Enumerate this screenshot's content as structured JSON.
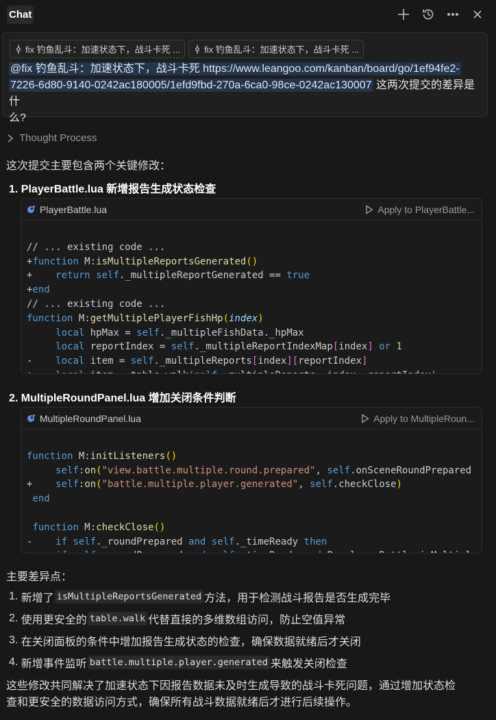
{
  "header": {
    "title": "Chat",
    "icons": [
      "plus-icon",
      "history-icon",
      "more-icon",
      "close-icon"
    ]
  },
  "prompt": {
    "chips": [
      "fix 钓鱼乱斗：加速状态下，战斗卡死 ...",
      "fix 钓鱼乱斗：加速状态下，战斗卡死 ..."
    ],
    "mention_line1": "@fix 钓鱼乱斗：加速状态下，战斗卡死 https://www.leangoo.com/kanban/board/go/1ef94fe2-",
    "mention_line2": "7226-6d80-9140-0242ac180005/1efd9fbd-270a-6ca0-98ce-0242ac130007",
    "question_part1": " 这两次提交的差异是什",
    "question_part2": "么?"
  },
  "thought_process": "Thought Process",
  "intro": "这次提交主要包含两个关键修改：",
  "sections": [
    {
      "number": "1.",
      "title": "PlayerBattle.lua 新增报告生成状态检查",
      "file": "PlayerBattle.lua",
      "apply": "Apply to PlayerBattle...",
      "lines": [
        "// ... existing code ...",
        "+function M:isMultipleReportsGenerated()",
        "+    return self._multipleReportGenerated == true",
        "+end",
        "// ... existing code ...",
        "function M:getMultiplePlayerFishHp(index)",
        "     local hpMax = self._multipleFishData._hpMax",
        "     local reportIndex = self._multipleReportIndexMap[index] or 1",
        "-    local item = self._multipleReports[index][reportIndex]",
        "+    local item = table.walk(self._multipleReports, index, reportIndex)"
      ]
    },
    {
      "number": "2.",
      "title": "MultipleRoundPanel.lua 增加关闭条件判断",
      "file": "MultipleRoundPanel.lua",
      "apply": "Apply to MultipleRoun...",
      "lines": [
        "function M:initListeners()",
        "     self:on(\"view.battle.multiple.round.prepared\", self.onSceneRoundPrepared",
        "+    self:on(\"battle.multiple.player.generated\", self.checkClose)",
        " end",
        "",
        " function M:checkClose()",
        "-    if self._roundPrepared and self._timeReady then",
        "+    if self._roundPrepared and self._timeReady and P._playerBattle:isMultipl"
      ]
    }
  ],
  "diff_heading": "主要差异点：",
  "diff_points": [
    {
      "num": "1.",
      "before": "新增了",
      "code": "isMultipleReportsGenerated",
      "after": "方法，用于检测战斗报告是否生成完毕"
    },
    {
      "num": "2.",
      "before": "使用更安全的",
      "code": "table.walk",
      "after": "代替直接的多维数组访问，防止空值异常"
    },
    {
      "num": "3.",
      "before": "在关闭面板的条件中增加报告生成状态的检查，确保数据就绪后才关闭",
      "code": "",
      "after": ""
    },
    {
      "num": "4.",
      "before": "新增事件监听",
      "code": "battle.multiple.player.generated",
      "after": "来触发关闭检查"
    }
  ],
  "conclusion_line1": "这些修改共同解决了加速状态下因报告数据未及时生成导致的战斗卡死问题，通过增加状态检",
  "conclusion_line2": "查和更安全的数据访问方式，确保所有战斗数据就绪后才进行后续操作。"
}
